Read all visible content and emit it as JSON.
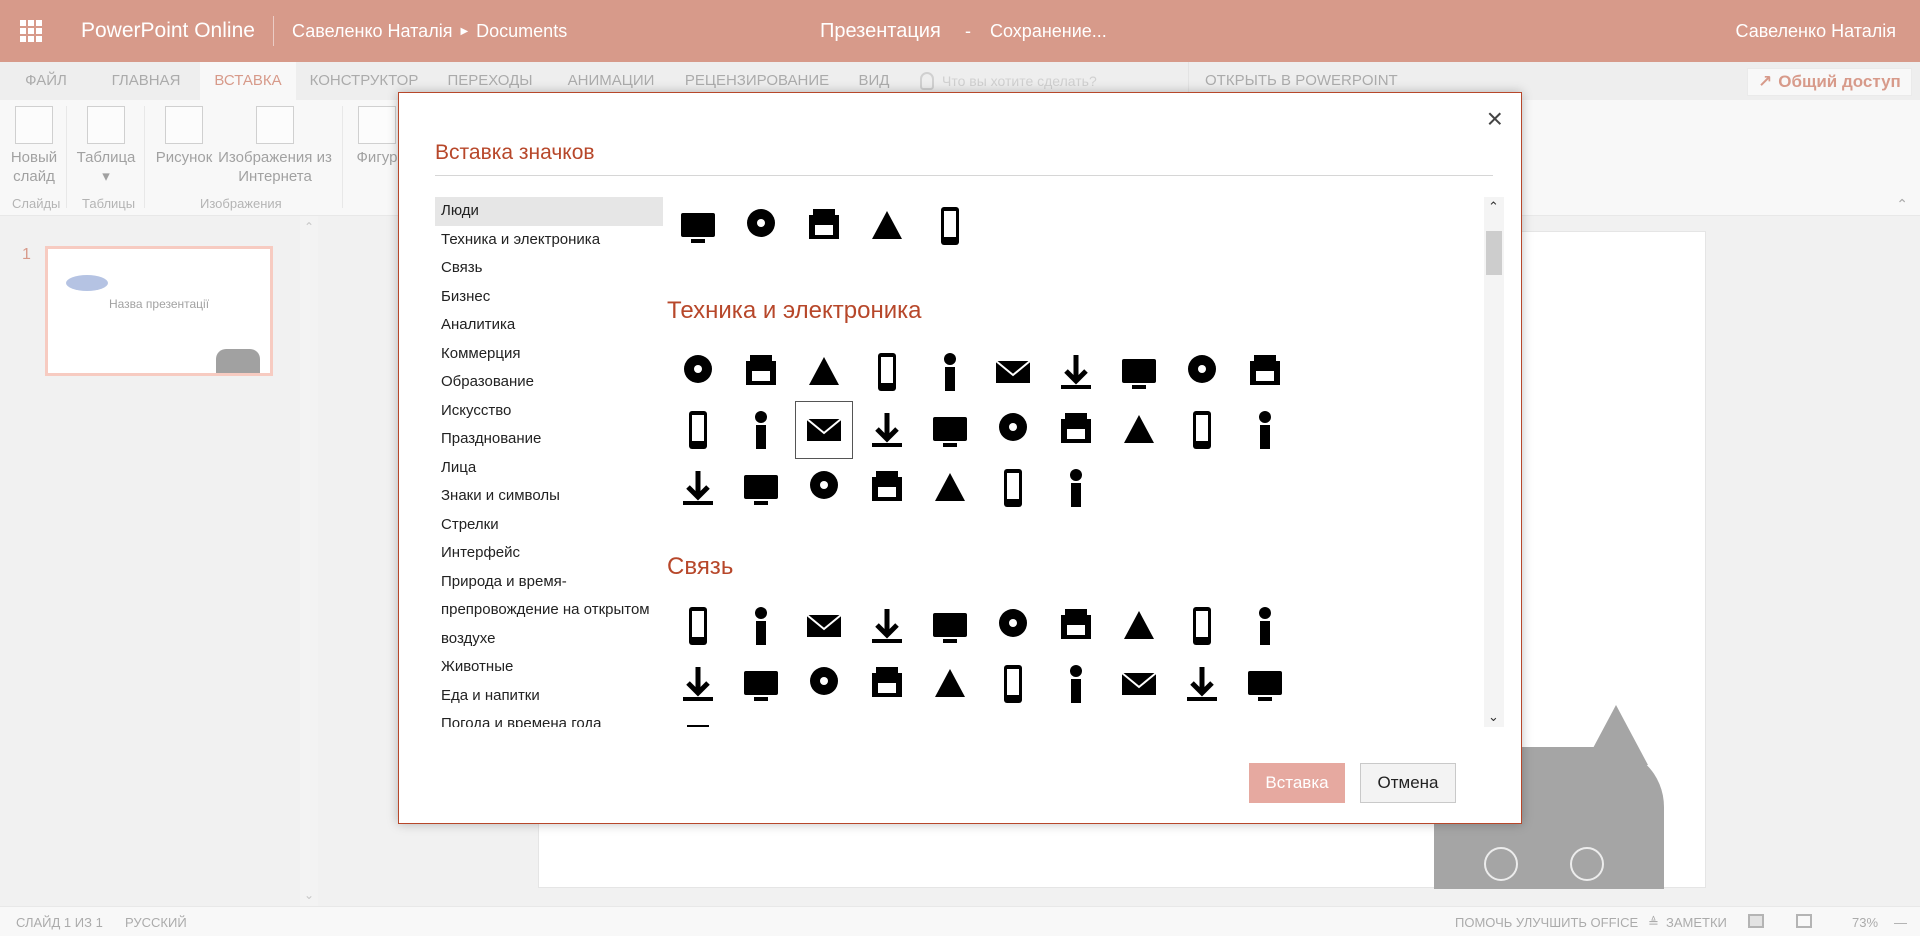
{
  "titlebar": {
    "app_name": "PowerPoint Online",
    "user_path": "Савеленко Наталія",
    "folder": "Documents",
    "doc_title": "Презентация",
    "dash": "-",
    "save_status": "Сохранение...",
    "user_name": "Савеленко Наталія"
  },
  "ribbon_tabs": [
    "ФАЙЛ",
    "ГЛАВНАЯ",
    "ВСТАВКА",
    "КОНСТРУКТОР",
    "ПЕРЕХОДЫ",
    "АНИМАЦИИ",
    "РЕЦЕНЗИРОВАНИЕ",
    "ВИД"
  ],
  "active_tab": "ВСТАВКА",
  "tell_me": "Что вы хотите сделать?",
  "open_in_ppt": "ОТКРЫТЬ В POWERPOINT",
  "share": "Общий доступ",
  "ribbon": {
    "new_slide": "Новый слайд",
    "table": "Таблица",
    "picture": "Рисунок",
    "online_pictures": "Изображения из Интернета",
    "shapes": "Фигур",
    "group_slides": "Слайды",
    "group_tables": "Таблицы",
    "group_images": "Изображения"
  },
  "thumbnail": {
    "number": "1",
    "title": "Назва презентації"
  },
  "statusbar": {
    "slide_counter": "СЛАЙД 1 ИЗ 1",
    "language": "РУССКИЙ",
    "help_improve": "ПОМОЧЬ УЛУЧШИТЬ OFFICE",
    "notes": "ЗАМЕТКИ",
    "zoom": "73%"
  },
  "dialog": {
    "title": "Вставка значков",
    "close": "×",
    "categories": [
      "Люди",
      "Техника и электроника",
      "Связь",
      "Бизнес",
      "Аналитика",
      "Коммерция",
      "Образование",
      "Искусство",
      "Празднование",
      "Лица",
      "Знаки и символы",
      "Стрелки",
      "Интерфейс",
      "Природа и время­препровождение на открытом воздухе",
      "Животные",
      "Еда и напитки",
      "Погода и времена года"
    ],
    "selected_category": "Люди",
    "sections": [
      {
        "title": "Техника и электроника"
      },
      {
        "title": "Связь"
      }
    ],
    "people_icons": [
      "running-person-icon",
      "elderly-person-icon",
      "wheelchair-icon",
      "speaker-at-podium-icon",
      "presenter-board-icon"
    ],
    "tech_icons": [
      "desktop-computer-icon",
      "laptop-icon",
      "monitor-icon",
      "smartphone-icon",
      "tablet-icon",
      "printer-icon",
      "fax-printer-icon",
      "shredder-icon",
      "copier-icon",
      "scanner-icon",
      "wifi-router-icon",
      "radio-icon",
      "typewriter-icon",
      "cd-disc-icon",
      "floppy-disk-icon",
      "camera-icon",
      "webcam-icon",
      "gamepad-icon",
      "earbuds-icon",
      "headphones-icon",
      "vinyl-record-icon",
      "speakers-icon",
      "remote-control-icon",
      "dvd-player-icon",
      "tv-icon",
      "projector-screen-icon",
      "projector-icon"
    ],
    "comm_icons": [
      "speech-bubble-icon",
      "conversation-icon",
      "thought-bubble-icon",
      "network-hub-icon",
      "envelope-icon",
      "open-letter-icon",
      "email-at-icon",
      "postage-stamp-icon",
      "download-icon",
      "cloud-download-icon",
      "chain-link-icon",
      "paper-plane-icon",
      "share-arrow-icon",
      "phone-handset-icon",
      "desk-phone-icon",
      "headset-agent-icon",
      "paperclip-person-icon",
      "microphone-icon",
      "megaphone-icon",
      "satellite-dish-icon",
      "partial-icon-1",
      "partial-icon-2"
    ],
    "insert_button": "Вставка",
    "cancel_button": "Отмена"
  },
  "colors": {
    "brand": "#b7472a",
    "insert_disabled": "#e6a9a0"
  }
}
